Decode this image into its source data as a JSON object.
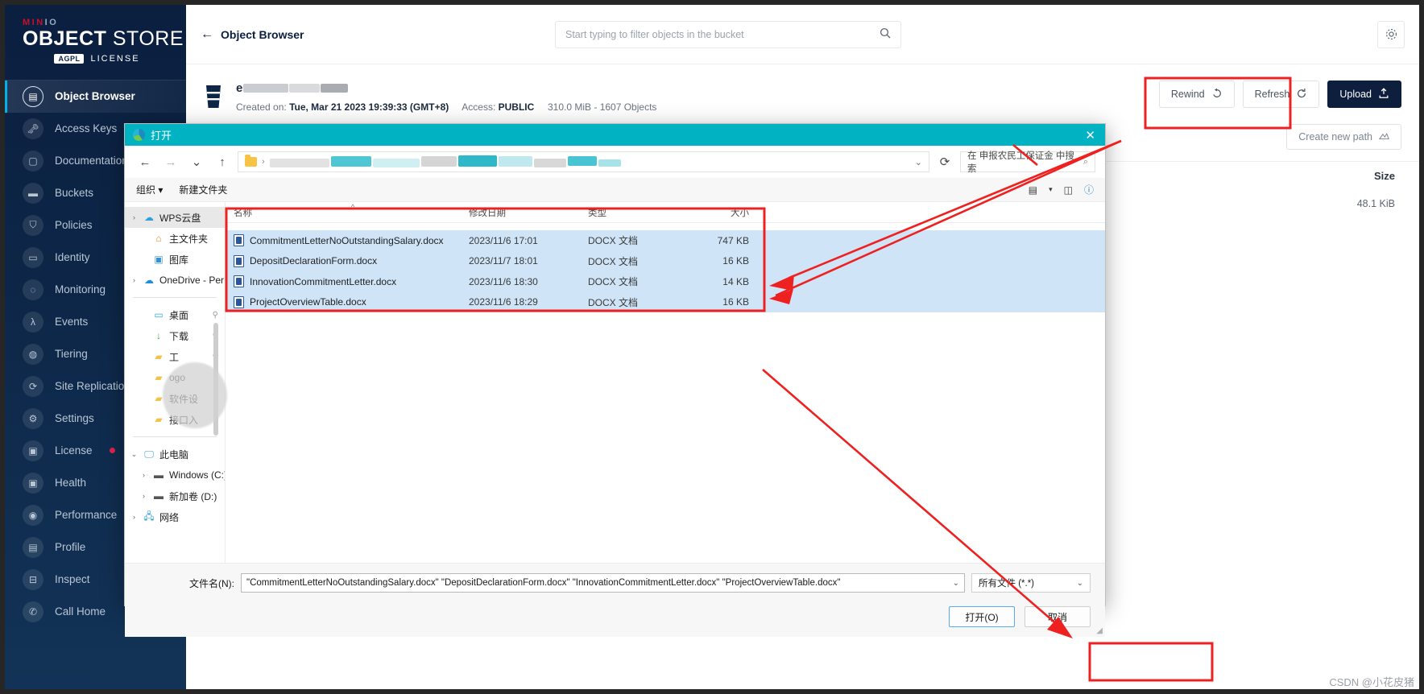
{
  "app": {
    "brand": {
      "minio": "MIN",
      "minio_io": "IO",
      "object": "OBJECT",
      "store": "STORE",
      "agpl": "AGPL",
      "license": "LICENSE"
    },
    "sidebar": {
      "items": [
        {
          "label": "Object Browser",
          "icon": "object-browser-icon",
          "active": true
        },
        {
          "label": "Access Keys",
          "icon": "key-icon"
        },
        {
          "label": "Documentation",
          "icon": "book-icon"
        },
        {
          "label": "Buckets",
          "icon": "bucket-icon"
        },
        {
          "label": "Policies",
          "icon": "shield-icon"
        },
        {
          "label": "Identity",
          "icon": "identity-icon",
          "chevron": "⌄"
        },
        {
          "label": "Monitoring",
          "icon": "monitoring-icon",
          "chevron": "⌄"
        },
        {
          "label": "Events",
          "icon": "lambda-icon"
        },
        {
          "label": "Tiering",
          "icon": "tiering-icon"
        },
        {
          "label": "Site Replication",
          "icon": "replication-icon"
        },
        {
          "label": "Settings",
          "icon": "gear-icon"
        },
        {
          "label": "License",
          "icon": "license-icon",
          "badge": "dot"
        },
        {
          "label": "Health",
          "icon": "health-icon"
        },
        {
          "label": "Performance",
          "icon": "performance-icon"
        },
        {
          "label": "Profile",
          "icon": "profile-icon"
        },
        {
          "label": "Inspect",
          "icon": "inspect-icon"
        },
        {
          "label": "Call Home",
          "icon": "phone-icon"
        }
      ]
    },
    "header": {
      "back_label": "Object Browser",
      "back_arrow": "←",
      "filter_placeholder": "Start typing to filter objects in the bucket",
      "search_icon": "search-icon",
      "settings_icon": "gear-icon"
    },
    "bucket": {
      "name_prefix": "e",
      "created_label": "Created on:",
      "created_value": "Tue, Mar 21 2023 19:39:33 (GMT+8)",
      "access_label": "Access:",
      "access_value": "PUBLIC",
      "stats": "310.0 MiB - 1607 Objects"
    },
    "actions": {
      "rewind": "Rewind",
      "rewind_icon": "rewind-icon",
      "refresh": "Refresh",
      "refresh_icon": "refresh-icon",
      "upload": "Upload",
      "upload_icon": "upload-icon",
      "create_new_path": "Create new path",
      "create_new_path_icon": "new-path-icon"
    },
    "table": {
      "size_header": "Size",
      "size_value": "48.1 KiB"
    }
  },
  "dialog": {
    "title": "打开",
    "title_icon": "browser-globe-icon",
    "close_icon": "close-icon",
    "nav": {
      "back_icon": "←",
      "forward_icon": "→",
      "history_icon": "⌄",
      "up_icon": "↑",
      "address_caret": "⌄",
      "refresh_icon": "⟳",
      "search_value": "在 申报农民工保证金 中搜索",
      "search_icon": "search-icon"
    },
    "commands": [
      {
        "label": "组织",
        "caret": "▾"
      },
      {
        "label": "新建文件夹"
      }
    ],
    "view_icons": [
      "list-view-icon",
      "view-caret-icon",
      "preview-pane-icon",
      "help-icon"
    ],
    "tree": [
      {
        "label": "WPS云盘",
        "icon": "wps-cloud-icon",
        "expander": "›",
        "selected": true,
        "indent": 0
      },
      {
        "label": "主文件夹",
        "icon": "home-icon",
        "indent": 1
      },
      {
        "label": "图库",
        "icon": "gallery-icon",
        "indent": 1
      },
      {
        "label": "OneDrive - Per",
        "icon": "onedrive-icon",
        "expander": "›",
        "indent": 0
      },
      {
        "separator": true
      },
      {
        "label": "桌面",
        "icon": "desktop-icon",
        "pin": "📌",
        "indent": 1
      },
      {
        "label": "下载",
        "icon": "download-icon",
        "pin": "📌",
        "indent": 1
      },
      {
        "label": "工",
        "icon": "folder-icon",
        "pin": "📌",
        "indent": 1
      },
      {
        "label": "ogo",
        "icon": "folder-icon",
        "indent": 1
      },
      {
        "label": "软件设",
        "icon": "folder-icon",
        "indent": 1
      },
      {
        "label": "接口入",
        "icon": "folder-icon",
        "indent": 1
      },
      {
        "separator": true
      },
      {
        "label": "此电脑",
        "icon": "computer-icon",
        "expander": "⌄",
        "indent": 0
      },
      {
        "label": "Windows (C:)",
        "icon": "drive-icon",
        "expander": "›",
        "indent": 1
      },
      {
        "label": "新加卷 (D:)",
        "icon": "drive-icon",
        "expander": "›",
        "indent": 1
      },
      {
        "label": "网络",
        "icon": "network-icon",
        "expander": "›",
        "indent": 0
      }
    ],
    "columns": [
      "名称",
      "修改日期",
      "类型",
      "大小"
    ],
    "sort_caret": "^",
    "files": [
      {
        "name": "CommitmentLetterNoOutstandingSalary.docx",
        "date": "2023/11/6 17:01",
        "type": "DOCX 文档",
        "size": "747 KB",
        "selected": true
      },
      {
        "name": "DepositDeclarationForm.docx",
        "date": "2023/11/7 18:01",
        "type": "DOCX 文档",
        "size": "16 KB",
        "selected": true
      },
      {
        "name": "InnovationCommitmentLetter.docx",
        "date": "2023/11/6 18:30",
        "type": "DOCX 文档",
        "size": "14 KB",
        "selected": true
      },
      {
        "name": "ProjectOverviewTable.docx",
        "date": "2023/11/6 18:29",
        "type": "DOCX 文档",
        "size": "16 KB",
        "selected": true
      }
    ],
    "footer": {
      "filename_label": "文件名(N):",
      "filename_value": "\"CommitmentLetterNoOutstandingSalary.docx\" \"DepositDeclarationForm.docx\" \"InnovationCommitmentLetter.docx\" \"ProjectOverviewTable.docx\"",
      "filename_caret": "⌄",
      "filter_value": "所有文件 (*.*)",
      "filter_caret": "⌄",
      "open_button": "打开(O)",
      "cancel_button": "取消"
    }
  },
  "watermark": "CSDN @小花皮猪",
  "colors": {
    "accent": "#00b2c2",
    "sidebar": "#0b1f3f",
    "primary_button": "#0d1f3d",
    "annotation_red": "#ef2020",
    "selection_blue": "#cfe4f7"
  }
}
